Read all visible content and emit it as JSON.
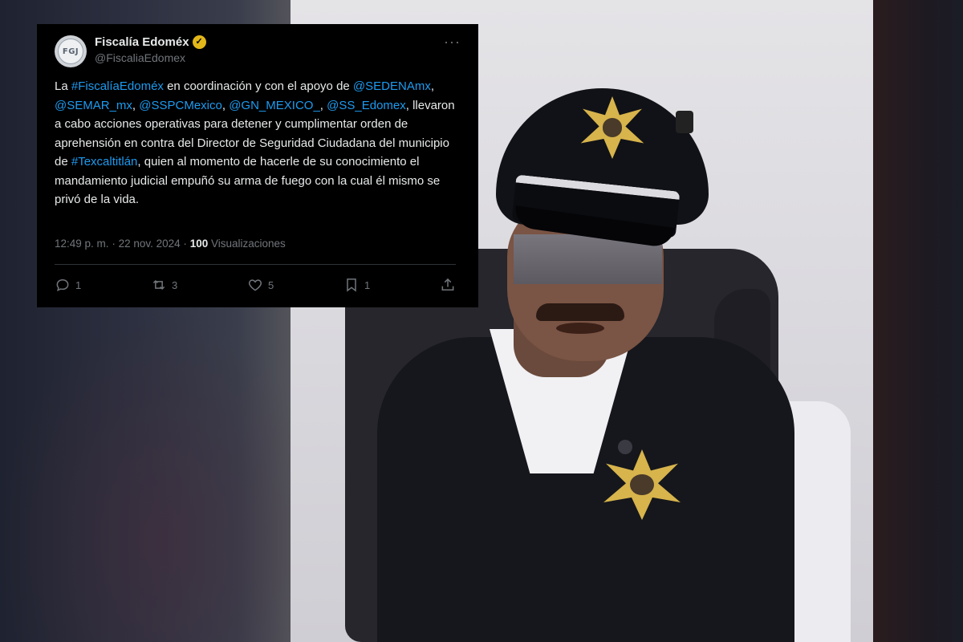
{
  "tweet": {
    "avatar_text": "FGJ",
    "author_name": "Fiscalía Edoméx",
    "handle": "@FiscaliaEdomex",
    "more_icon": "more-dots-icon",
    "verified_icon": "verified-badge-icon",
    "body": [
      {
        "t": "La ",
        "link": false
      },
      {
        "t": "#FiscalíaEdoméx",
        "link": true
      },
      {
        "t": " en coordinación y con el apoyo de ",
        "link": false
      },
      {
        "t": "@SEDENAmx",
        "link": true
      },
      {
        "t": ", ",
        "link": false
      },
      {
        "t": "@SEMAR_mx",
        "link": true
      },
      {
        "t": ", ",
        "link": false
      },
      {
        "t": "@SSPCMexico",
        "link": true
      },
      {
        "t": ", ",
        "link": false
      },
      {
        "t": "@GN_MEXICO_",
        "link": true
      },
      {
        "t": ", ",
        "link": false
      },
      {
        "t": "@SS_Edomex",
        "link": true
      },
      {
        "t": ", llevaron a cabo acciones operativas para detener y cumplimentar orden de aprehensión en contra del Director de Seguridad Ciudadana del municipio de ",
        "link": false
      },
      {
        "t": "#Texcaltitlán",
        "link": true
      },
      {
        "t": ", quien al momento de hacerle de su conocimiento el mandamiento judicial empuñó su arma de fuego con la cual él mismo se privó de la vida.",
        "link": false
      }
    ],
    "time": "12:49 p. m.",
    "dot": "·",
    "date": "22 nov. 2024",
    "views_count": "100",
    "views_label": "Visualizaciones",
    "actions": {
      "replies": "1",
      "reposts": "3",
      "likes": "5",
      "bookmarks": "1"
    },
    "colors": {
      "link": "#1d9bf0",
      "muted": "#71767b",
      "text": "#e7e9ea",
      "background": "#000000",
      "verified": "#e2b719"
    }
  },
  "photo": {
    "subject": "uniformed-officer-photo"
  }
}
